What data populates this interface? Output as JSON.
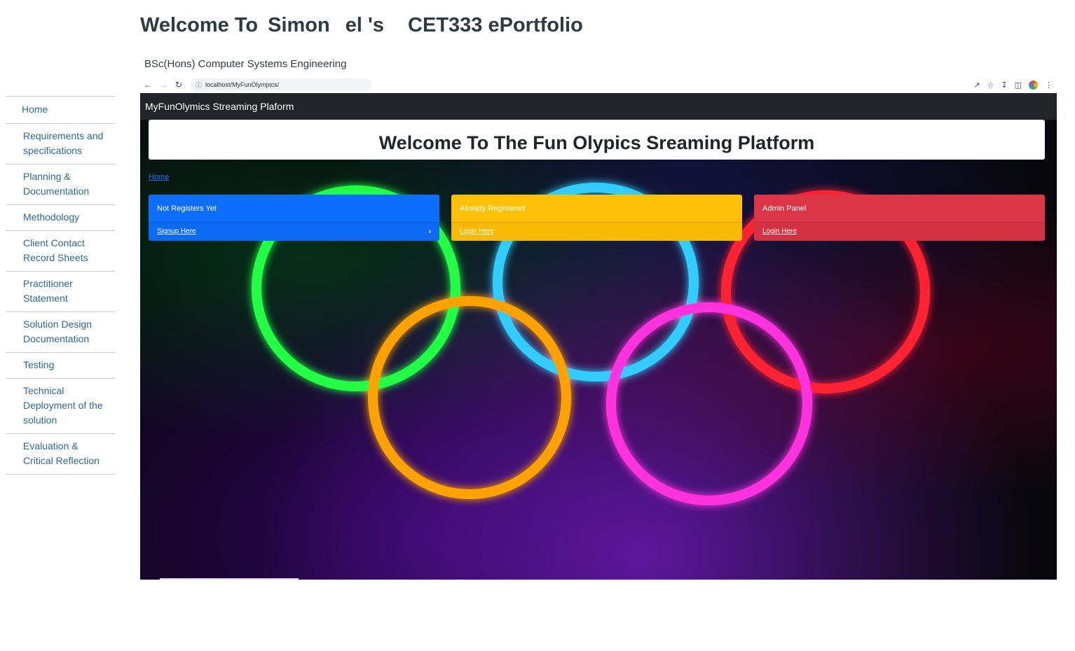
{
  "page": {
    "title_parts": [
      "Welcome To",
      "Simon",
      "el 's",
      "CET333 ePortfolio"
    ],
    "subtitle": "BSc(Hons) Computer Systems Engineering"
  },
  "sidebar": {
    "items": [
      {
        "label": "Home"
      },
      {
        "label": "Requirements and specifications"
      },
      {
        "label": "Planning & Documentation"
      },
      {
        "label": "Methodology"
      },
      {
        "label": "Client Contact Record Sheets"
      },
      {
        "label": "Practitioner Statement"
      },
      {
        "label": "Solution Design Documentation"
      },
      {
        "label": "Testing"
      },
      {
        "label": "Technical Deployment of the solution"
      },
      {
        "label": "Evaluation & Critical Reflection"
      }
    ]
  },
  "browser": {
    "url": "localhost/MyFunOlympics/",
    "icons": [
      "back-arrow-icon",
      "forward-arrow-icon",
      "reload-icon",
      "info-icon",
      "share-icon",
      "star-icon",
      "download-icon",
      "sidepanel-icon",
      "profile-icon",
      "kebab-menu-icon"
    ]
  },
  "app": {
    "brand": "MyFunOlymics Streaming Plaform",
    "heading": "Welcome To The Fun Olypics Sreaming Platform",
    "breadcrumb": "Home",
    "cards": [
      {
        "title": "Not Registers Yet",
        "link": "Signup Here",
        "color": "#0d6efd"
      },
      {
        "title": "Already Registered",
        "link": "Login Here",
        "color": "#ffc107"
      },
      {
        "title": "Admin Panel",
        "link": "Login Here",
        "color": "#dc3545"
      }
    ],
    "ring_colors": [
      "#22ff44",
      "#33ccff",
      "#ff2233",
      "#ffa200",
      "#ff33dd"
    ]
  }
}
